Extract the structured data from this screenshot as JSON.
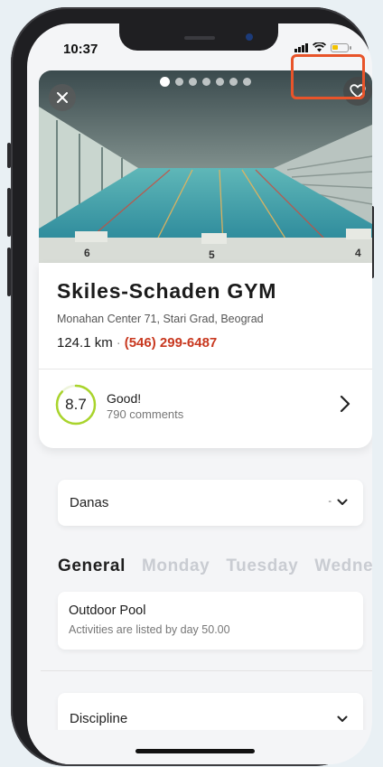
{
  "status_bar": {
    "time": "10:37"
  },
  "carousel": {
    "active_index": 0,
    "count": 7
  },
  "gym": {
    "name": "Skiles-Schaden GYM",
    "address": "Monahan Center 71, Stari Grad, Beograd",
    "distance": "124.1 km",
    "separator": "·",
    "phone": "(546) 299-6487"
  },
  "rating": {
    "score": "8.7",
    "label": "Good!",
    "comments": "790 comments"
  },
  "day_select": {
    "label": "Danas",
    "value": "-"
  },
  "tabs": [
    {
      "label": "General",
      "active": true
    },
    {
      "label": "Monday",
      "active": false
    },
    {
      "label": "Tuesday",
      "active": false
    },
    {
      "label": "Wednesday",
      "active": false
    }
  ],
  "activity": {
    "name": "Outdoor Pool",
    "description": "Activities are listed by day 50.00"
  },
  "discipline": {
    "label": "Discipline"
  },
  "colors": {
    "accent": "#c8381f",
    "highlight": "#e8542a",
    "rating_ring": "#a9d42c"
  }
}
